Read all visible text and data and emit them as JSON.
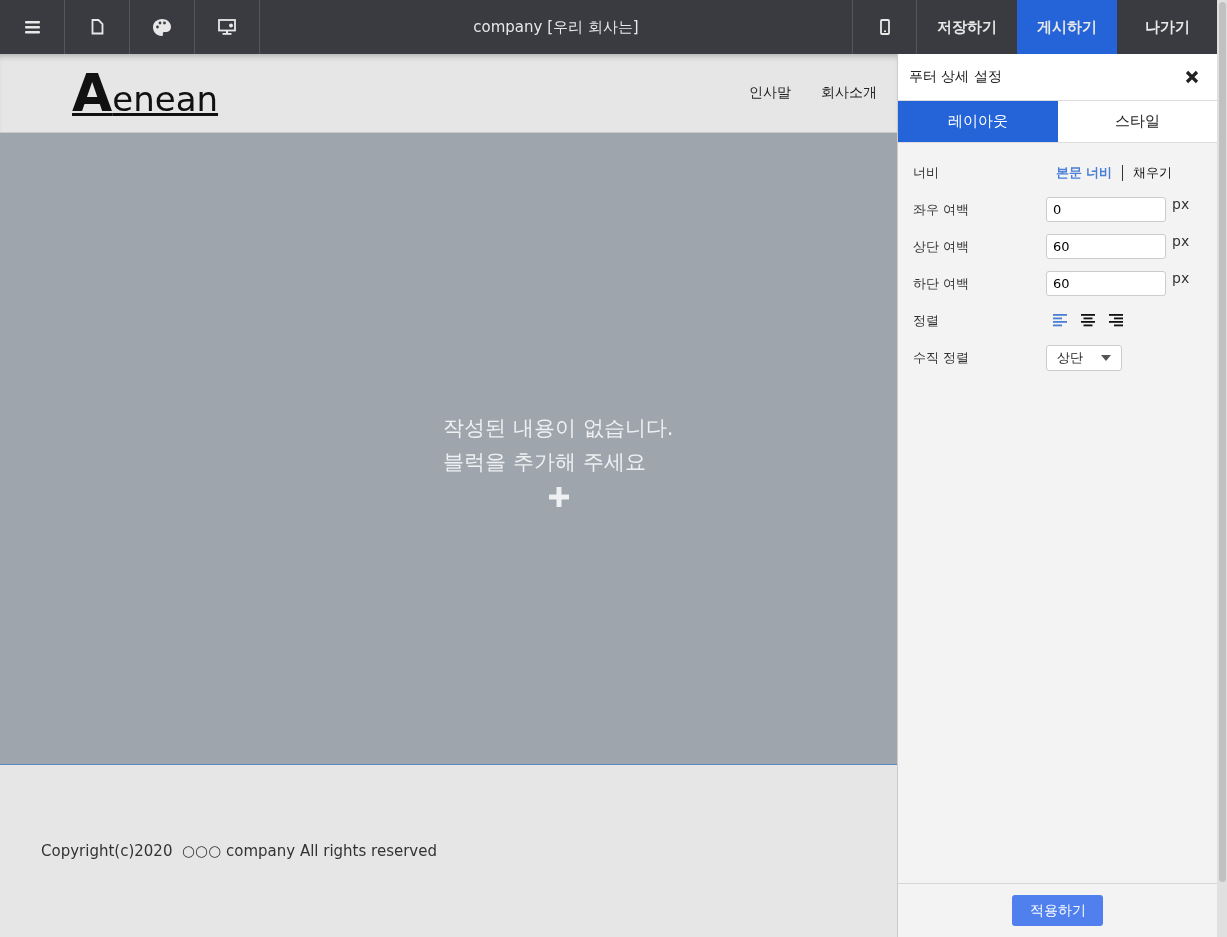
{
  "toolbar": {
    "title": "company [우리 회사는]",
    "actions": [
      {
        "label": "저장하기",
        "selected": false
      },
      {
        "label": "게시하기",
        "selected": true
      },
      {
        "label": "나가기",
        "selected": false
      }
    ]
  },
  "site_header": {
    "logo": "Aenean",
    "nav": [
      "인사말",
      "회사소개"
    ]
  },
  "canvas": {
    "empty_message": [
      "작성된 내용이 없습니다.",
      "블럭을 추가해 주세요"
    ]
  },
  "site_footer": {
    "copyright": "Copyright(c)2020  ○○○ company All rights reserved"
  },
  "panel": {
    "title": "푸터 상세 설정",
    "tabs": [
      {
        "label": "레이아웃",
        "selected": true
      },
      {
        "label": "스타일",
        "selected": false
      }
    ],
    "fields": [
      {
        "kind": "toggle",
        "label": "너비",
        "options": [
          {
            "label": "본문 너비",
            "selected": true
          },
          {
            "label": "채우기",
            "selected": false
          }
        ]
      },
      {
        "kind": "number",
        "label": "좌우 여백",
        "value": "0",
        "unit": "px"
      },
      {
        "kind": "number",
        "label": "상단 여백",
        "value": "60",
        "unit": "px"
      },
      {
        "kind": "number",
        "label": "하단 여백",
        "value": "60",
        "unit": "px"
      },
      {
        "kind": "align",
        "label": "정렬",
        "options": [
          {
            "kind": "left",
            "selected": true
          },
          {
            "kind": "center",
            "selected": false
          },
          {
            "kind": "right",
            "selected": false
          }
        ]
      },
      {
        "kind": "select",
        "label": "수직 정렬",
        "value": "상단"
      }
    ],
    "apply": "적용하기"
  }
}
